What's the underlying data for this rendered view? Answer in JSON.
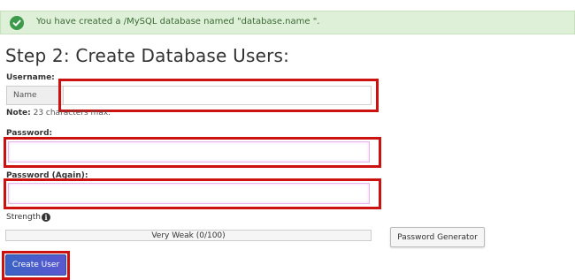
{
  "alert": {
    "icon": "check-circle-icon",
    "text": "You have created a /MySQL database named \"database.name \".",
    "color": "#dff0d8"
  },
  "page_title": "Step 2: Create Database Users:",
  "username": {
    "label": "Username:",
    "prefix": "Name",
    "value": "",
    "note_label": "Note:",
    "note_text": " 23 characters max."
  },
  "password": {
    "label": "Password:",
    "value": ""
  },
  "password_again": {
    "label": "Password (Again):",
    "value": ""
  },
  "strength": {
    "label": "Strength",
    "icon": "info-circle-icon",
    "meter_text": "Very Weak (0/100)",
    "value": 0,
    "max": 100
  },
  "buttons": {
    "password_generator": "Password Generator",
    "create_user": "Create User"
  },
  "highlight_color": "#cc1111"
}
